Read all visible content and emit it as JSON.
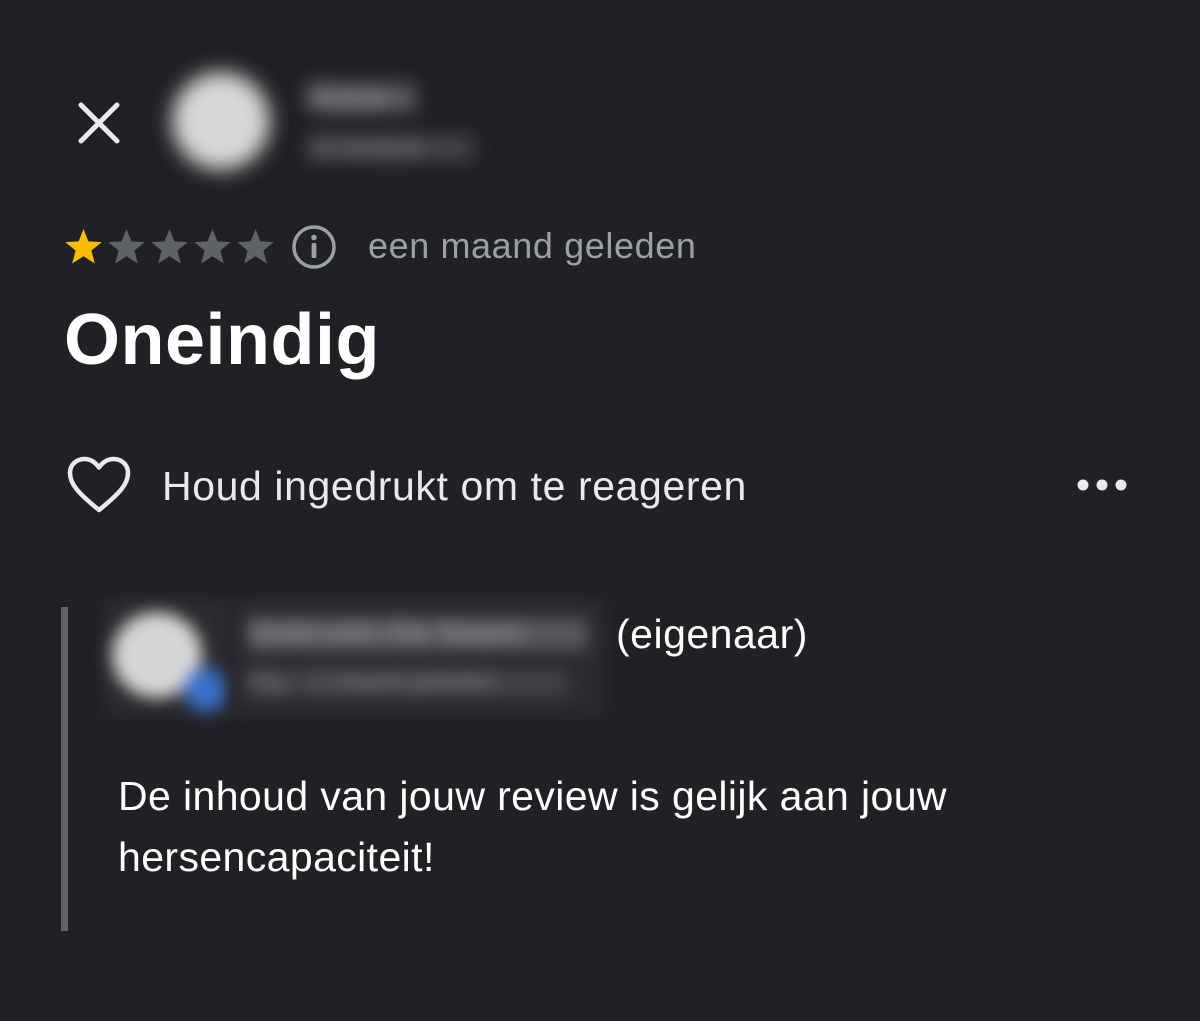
{
  "header": {
    "close_icon": "close-icon",
    "reviewer_name": "Klaas",
    "reviewer_sub": "12 reviews"
  },
  "review": {
    "rating": 1,
    "max_rating": 5,
    "star_color_filled": "#fbbc04",
    "star_color_empty": "#5f6368",
    "info_icon": "info-icon",
    "time_ago": "een maand geleden",
    "text": "Oneindig"
  },
  "reactions": {
    "heart_icon": "heart-icon",
    "hint": "Houd ingedrukt om te reageren",
    "more_icon": "more-horizontal-icon"
  },
  "owner_reply": {
    "owner_name": "Gebruikt De Naam",
    "owner_sub": "Eig. · 1 maand geleden",
    "owner_tag": "(eigenaar)",
    "badge_color": "#3b6fc7",
    "text": "De inhoud van jouw review is gelijk aan jouw hersencapaciteit!"
  }
}
